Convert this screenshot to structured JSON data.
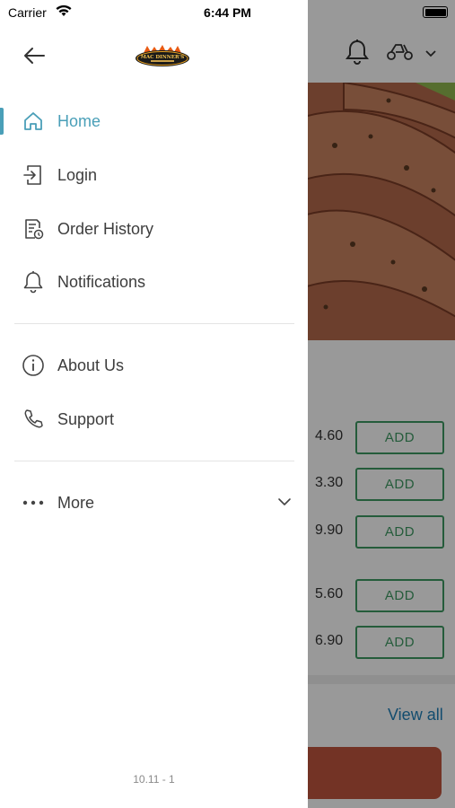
{
  "status_bar": {
    "carrier": "Carrier",
    "time": "6:44 PM"
  },
  "background": {
    "menu_rows": [
      {
        "price": "4.60",
        "button": "ADD"
      },
      {
        "price": "3.30",
        "button": "ADD"
      },
      {
        "price": "9.90",
        "button": "ADD"
      },
      {
        "price": "5.60",
        "button": "ADD"
      },
      {
        "price": "6.90",
        "button": "ADD"
      }
    ],
    "view_all": "View all",
    "colors": {
      "add_green": "#3f9a63",
      "link_blue": "#1f7fb8",
      "cart_red": "#c0563f"
    }
  },
  "drawer": {
    "logo_text": "MAC DINNER'S",
    "nav_items": [
      {
        "label": "Home",
        "icon": "home-icon",
        "active": true
      },
      {
        "label": "Login",
        "icon": "login-icon",
        "active": false
      },
      {
        "label": "Order History",
        "icon": "order-history-icon",
        "active": false
      },
      {
        "label": "Notifications",
        "icon": "bell-icon",
        "active": false
      }
    ],
    "secondary_items": [
      {
        "label": "About Us",
        "icon": "info-icon"
      },
      {
        "label": "Support",
        "icon": "phone-icon"
      }
    ],
    "more": {
      "label": "More",
      "icon": "more-dots-icon"
    },
    "version": "10.11 - 1",
    "colors": {
      "accent": "#4a9fb8",
      "text": "#3d3d3d"
    }
  }
}
